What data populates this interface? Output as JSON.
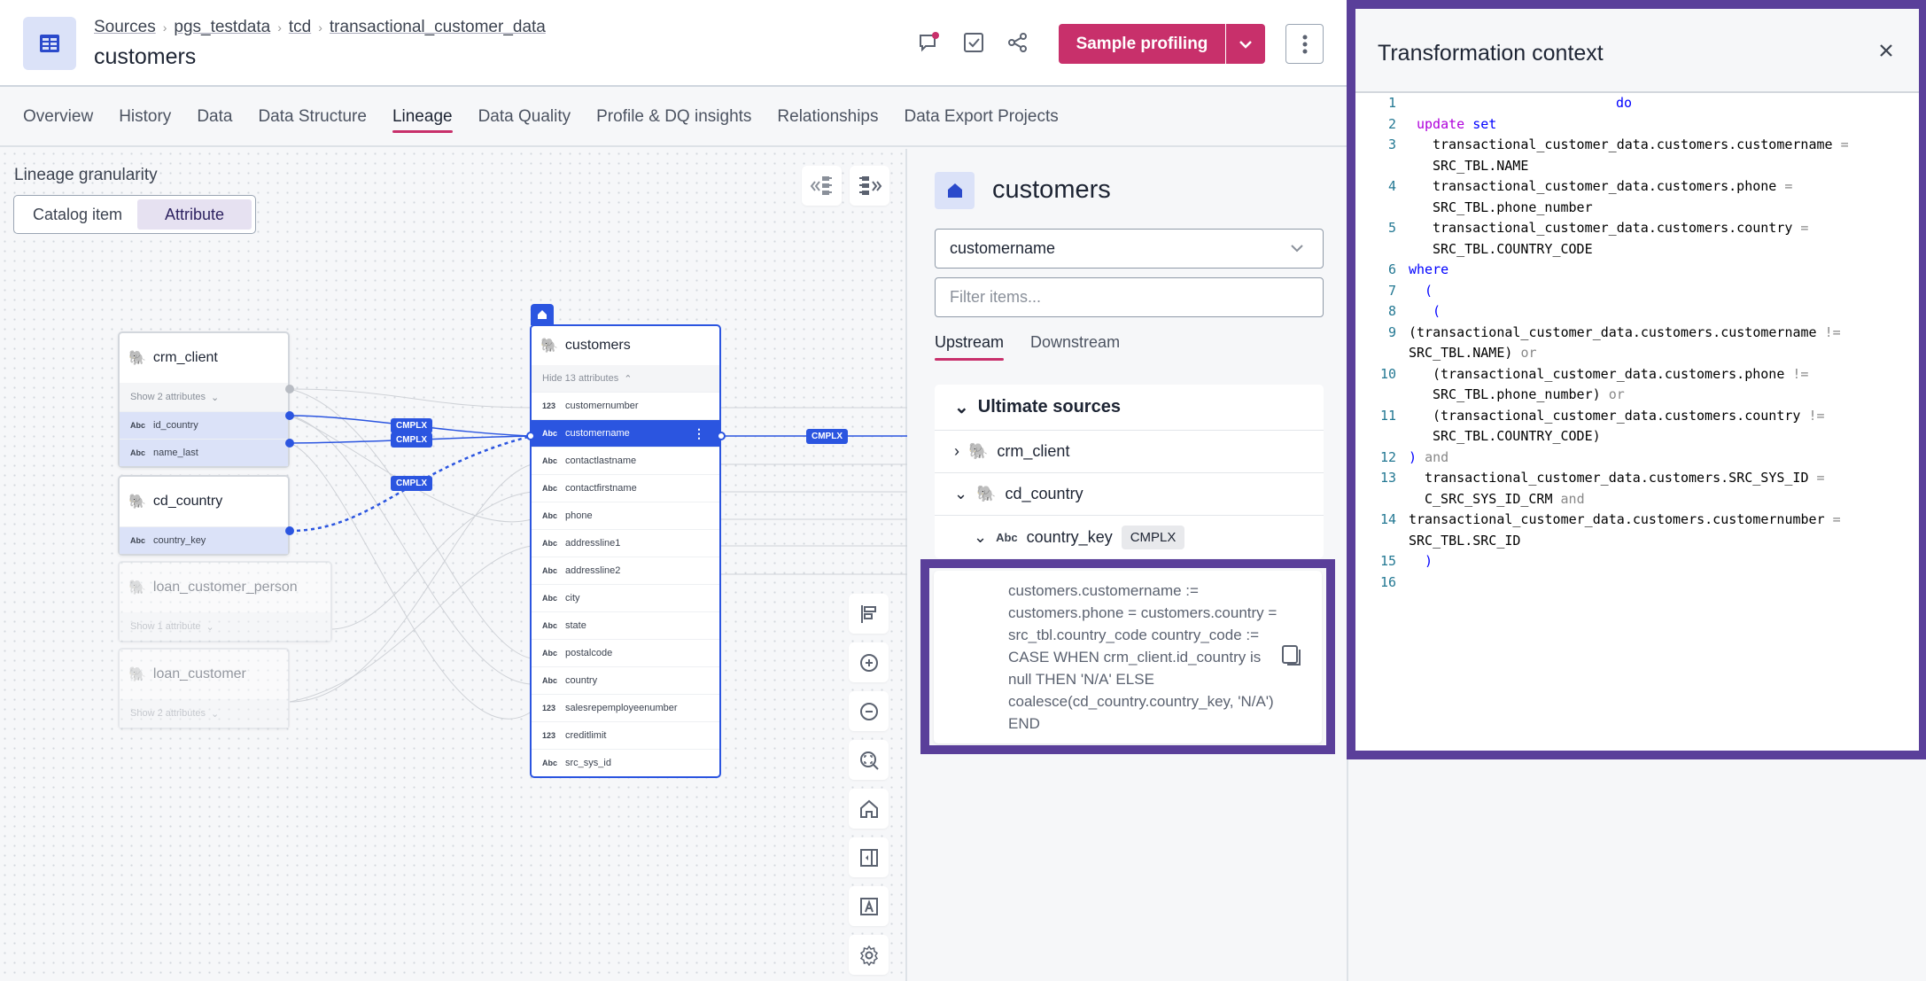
{
  "header": {
    "breadcrumb": [
      "Sources",
      "pgs_testdata",
      "tcd",
      "transactional_customer_data"
    ],
    "title": "customers",
    "primary_button": "Sample profiling",
    "accent_color": "#c8306b"
  },
  "tabs": [
    "Overview",
    "History",
    "Data",
    "Data Structure",
    "Lineage",
    "Data Quality",
    "Profile & DQ insights",
    "Relationships",
    "Data Export Projects"
  ],
  "active_tab": "Lineage",
  "canvas": {
    "granularity_label": "Lineage granularity",
    "granularity_options": [
      "Catalog item",
      "Attribute"
    ],
    "granularity_selected": "Attribute",
    "nodes": {
      "crm_client": {
        "name": "crm_client",
        "show": "Show 2 attributes",
        "attrs": [
          {
            "type": "Abc",
            "name": "id_country"
          },
          {
            "type": "Abc",
            "name": "name_last"
          }
        ]
      },
      "cd_country": {
        "name": "cd_country",
        "attrs": [
          {
            "type": "Abc",
            "name": "country_key"
          }
        ]
      },
      "loan_customer_person": {
        "name": "loan_customer_person",
        "show": "Show 1 attribute"
      },
      "loan_customer": {
        "name": "loan_customer",
        "show": "Show 2 attributes"
      },
      "customers": {
        "name": "customers",
        "hide": "Hide 13 attributes",
        "attrs": [
          {
            "type": "123",
            "name": "customernumber"
          },
          {
            "type": "Abc",
            "name": "customername"
          },
          {
            "type": "Abc",
            "name": "contactlastname"
          },
          {
            "type": "Abc",
            "name": "contactfirstname"
          },
          {
            "type": "Abc",
            "name": "phone"
          },
          {
            "type": "Abc",
            "name": "addressline1"
          },
          {
            "type": "Abc",
            "name": "addressline2"
          },
          {
            "type": "Abc",
            "name": "city"
          },
          {
            "type": "Abc",
            "name": "state"
          },
          {
            "type": "Abc",
            "name": "postalcode"
          },
          {
            "type": "Abc",
            "name": "country"
          },
          {
            "type": "123",
            "name": "salesrepemployeenumber"
          },
          {
            "type": "123",
            "name": "creditlimit"
          },
          {
            "type": "Abc",
            "name": "src_sys_id"
          }
        ],
        "selected_attr": "customername"
      }
    },
    "edge_badge": "CMPLX"
  },
  "detail": {
    "title": "customers",
    "attribute_select": "customername",
    "filter_placeholder": "Filter items...",
    "stream_tabs": [
      "Upstream",
      "Downstream"
    ],
    "active_stream": "Upstream",
    "section": "Ultimate sources",
    "sources": [
      {
        "name": "crm_client",
        "expanded": false
      },
      {
        "name": "cd_country",
        "expanded": true,
        "child": {
          "type": "Abc",
          "name": "country_key",
          "badge": "CMPLX"
        }
      }
    ],
    "expression": "customers.customername := customers.phone = customers.country = src_tbl.country_code country_code := CASE WHEN crm_client.id_country is null THEN 'N/A' ELSE coalesce(cd_country.country_key, 'N/A') END"
  },
  "transformation": {
    "title": "Transformation context",
    "lines": [
      {
        "n": "1",
        "code": "do"
      },
      {
        "n": "2",
        "code": "update set"
      },
      {
        "n": "3",
        "code": "transactional_customer_data.customers.customername = SRC_TBL.NAME"
      },
      {
        "n": "4",
        "code": "transactional_customer_data.customers.phone = SRC_TBL.phone_number"
      },
      {
        "n": "5",
        "code": "transactional_customer_data.customers.country = SRC_TBL.COUNTRY_CODE"
      },
      {
        "n": "6",
        "code": "where"
      },
      {
        "n": "7",
        "code": "("
      },
      {
        "n": "8",
        "code": "("
      },
      {
        "n": "9",
        "code": "(transactional_customer_data.customers.customername != SRC_TBL.NAME) or"
      },
      {
        "n": "10",
        "code": "(transactional_customer_data.customers.phone != SRC_TBL.phone_number) or"
      },
      {
        "n": "11",
        "code": "(transactional_customer_data.customers.country != SRC_TBL.COUNTRY_CODE)"
      },
      {
        "n": "12",
        "code": ") and"
      },
      {
        "n": "13",
        "code": "transactional_customer_data.customers.SRC_SYS_ID = C_SRC_SYS_ID_CRM and"
      },
      {
        "n": "14",
        "code": "transactional_customer_data.customers.customernumber = SRC_TBL.SRC_ID"
      },
      {
        "n": "15",
        "code": ")"
      },
      {
        "n": "16",
        "code": ""
      }
    ]
  }
}
